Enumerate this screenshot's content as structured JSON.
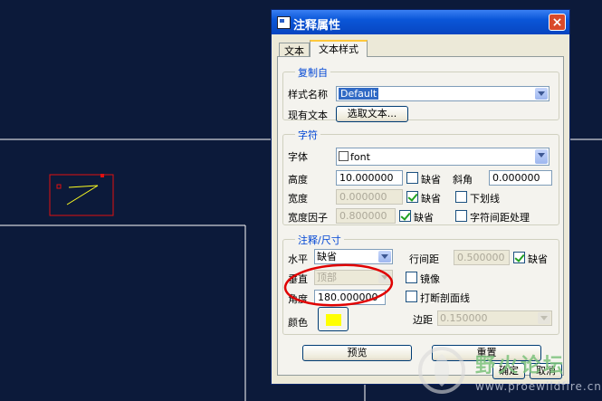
{
  "dialog": {
    "title": "注释属性",
    "close_label": "×",
    "tabs": [
      {
        "label": "文本"
      },
      {
        "label": "文本样式"
      }
    ],
    "copy_from": {
      "group_label": "复制自",
      "style_name_label": "样式名称",
      "style_name_value": "Default",
      "existing_text_label": "现有文本",
      "select_text_button": "选取文本..."
    },
    "char": {
      "group_label": "字符",
      "font_label": "字体",
      "font_value": "font",
      "height_label": "高度",
      "height_value": "10.000000",
      "height_default_label": "缺省",
      "slant_label": "斜角",
      "slant_value": "0.000000",
      "thickness_label": "宽度",
      "thickness_value": "0.000000",
      "thickness_default_label": "缺省",
      "underline_label": "下划线",
      "width_factor_label": "宽度因子",
      "width_factor_value": "0.800000",
      "width_factor_default_label": "缺省",
      "kerning_label": "字符间距处理"
    },
    "note": {
      "group_label": "注释/尺寸",
      "horizontal_label": "水平",
      "horizontal_value": "缺省",
      "vertical_label": "垂直",
      "vertical_value": "顶部",
      "angle_label": "角度",
      "angle_value": "180.000000",
      "color_label": "颜色",
      "color_value": "#ffff00",
      "line_spacing_label": "行间距",
      "line_spacing_value": "0.500000",
      "line_spacing_default_label": "缺省",
      "mirror_label": "镜像",
      "break_hatch_label": "打断剖面线",
      "margin_label": "边距",
      "margin_value": "0.150000"
    },
    "preview_button": "预览",
    "reset_button": "重置",
    "ok_button": "确定",
    "cancel_button": "取消"
  },
  "watermark": {
    "title": "野火论坛",
    "url": "www.proewildfire.cn"
  },
  "colors": {
    "canvas_bg": "#0c1a3a",
    "annotation_ellipse": "#e00000",
    "sketch_box": "#e01010",
    "sketch_line": "#ffff20"
  }
}
